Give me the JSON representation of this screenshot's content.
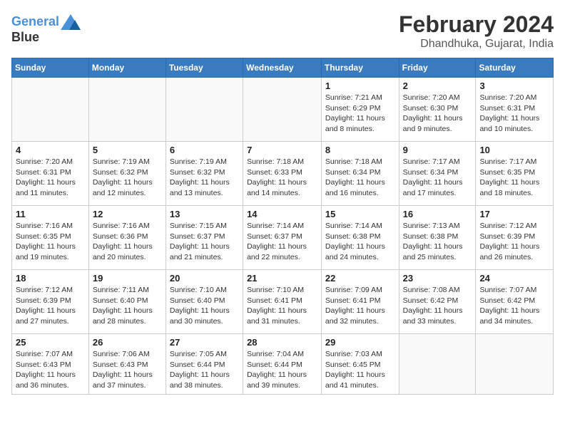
{
  "header": {
    "logo_line1": "General",
    "logo_line2": "Blue",
    "month_title": "February 2024",
    "location": "Dhandhuka, Gujarat, India"
  },
  "weekdays": [
    "Sunday",
    "Monday",
    "Tuesday",
    "Wednesday",
    "Thursday",
    "Friday",
    "Saturday"
  ],
  "weeks": [
    [
      {
        "day": "",
        "info": ""
      },
      {
        "day": "",
        "info": ""
      },
      {
        "day": "",
        "info": ""
      },
      {
        "day": "",
        "info": ""
      },
      {
        "day": "1",
        "info": "Sunrise: 7:21 AM\nSunset: 6:29 PM\nDaylight: 11 hours\nand 8 minutes."
      },
      {
        "day": "2",
        "info": "Sunrise: 7:20 AM\nSunset: 6:30 PM\nDaylight: 11 hours\nand 9 minutes."
      },
      {
        "day": "3",
        "info": "Sunrise: 7:20 AM\nSunset: 6:31 PM\nDaylight: 11 hours\nand 10 minutes."
      }
    ],
    [
      {
        "day": "4",
        "info": "Sunrise: 7:20 AM\nSunset: 6:31 PM\nDaylight: 11 hours\nand 11 minutes."
      },
      {
        "day": "5",
        "info": "Sunrise: 7:19 AM\nSunset: 6:32 PM\nDaylight: 11 hours\nand 12 minutes."
      },
      {
        "day": "6",
        "info": "Sunrise: 7:19 AM\nSunset: 6:32 PM\nDaylight: 11 hours\nand 13 minutes."
      },
      {
        "day": "7",
        "info": "Sunrise: 7:18 AM\nSunset: 6:33 PM\nDaylight: 11 hours\nand 14 minutes."
      },
      {
        "day": "8",
        "info": "Sunrise: 7:18 AM\nSunset: 6:34 PM\nDaylight: 11 hours\nand 16 minutes."
      },
      {
        "day": "9",
        "info": "Sunrise: 7:17 AM\nSunset: 6:34 PM\nDaylight: 11 hours\nand 17 minutes."
      },
      {
        "day": "10",
        "info": "Sunrise: 7:17 AM\nSunset: 6:35 PM\nDaylight: 11 hours\nand 18 minutes."
      }
    ],
    [
      {
        "day": "11",
        "info": "Sunrise: 7:16 AM\nSunset: 6:35 PM\nDaylight: 11 hours\nand 19 minutes."
      },
      {
        "day": "12",
        "info": "Sunrise: 7:16 AM\nSunset: 6:36 PM\nDaylight: 11 hours\nand 20 minutes."
      },
      {
        "day": "13",
        "info": "Sunrise: 7:15 AM\nSunset: 6:37 PM\nDaylight: 11 hours\nand 21 minutes."
      },
      {
        "day": "14",
        "info": "Sunrise: 7:14 AM\nSunset: 6:37 PM\nDaylight: 11 hours\nand 22 minutes."
      },
      {
        "day": "15",
        "info": "Sunrise: 7:14 AM\nSunset: 6:38 PM\nDaylight: 11 hours\nand 24 minutes."
      },
      {
        "day": "16",
        "info": "Sunrise: 7:13 AM\nSunset: 6:38 PM\nDaylight: 11 hours\nand 25 minutes."
      },
      {
        "day": "17",
        "info": "Sunrise: 7:12 AM\nSunset: 6:39 PM\nDaylight: 11 hours\nand 26 minutes."
      }
    ],
    [
      {
        "day": "18",
        "info": "Sunrise: 7:12 AM\nSunset: 6:39 PM\nDaylight: 11 hours\nand 27 minutes."
      },
      {
        "day": "19",
        "info": "Sunrise: 7:11 AM\nSunset: 6:40 PM\nDaylight: 11 hours\nand 28 minutes."
      },
      {
        "day": "20",
        "info": "Sunrise: 7:10 AM\nSunset: 6:40 PM\nDaylight: 11 hours\nand 30 minutes."
      },
      {
        "day": "21",
        "info": "Sunrise: 7:10 AM\nSunset: 6:41 PM\nDaylight: 11 hours\nand 31 minutes."
      },
      {
        "day": "22",
        "info": "Sunrise: 7:09 AM\nSunset: 6:41 PM\nDaylight: 11 hours\nand 32 minutes."
      },
      {
        "day": "23",
        "info": "Sunrise: 7:08 AM\nSunset: 6:42 PM\nDaylight: 11 hours\nand 33 minutes."
      },
      {
        "day": "24",
        "info": "Sunrise: 7:07 AM\nSunset: 6:42 PM\nDaylight: 11 hours\nand 34 minutes."
      }
    ],
    [
      {
        "day": "25",
        "info": "Sunrise: 7:07 AM\nSunset: 6:43 PM\nDaylight: 11 hours\nand 36 minutes."
      },
      {
        "day": "26",
        "info": "Sunrise: 7:06 AM\nSunset: 6:43 PM\nDaylight: 11 hours\nand 37 minutes."
      },
      {
        "day": "27",
        "info": "Sunrise: 7:05 AM\nSunset: 6:44 PM\nDaylight: 11 hours\nand 38 minutes."
      },
      {
        "day": "28",
        "info": "Sunrise: 7:04 AM\nSunset: 6:44 PM\nDaylight: 11 hours\nand 39 minutes."
      },
      {
        "day": "29",
        "info": "Sunrise: 7:03 AM\nSunset: 6:45 PM\nDaylight: 11 hours\nand 41 minutes."
      },
      {
        "day": "",
        "info": ""
      },
      {
        "day": "",
        "info": ""
      }
    ]
  ]
}
